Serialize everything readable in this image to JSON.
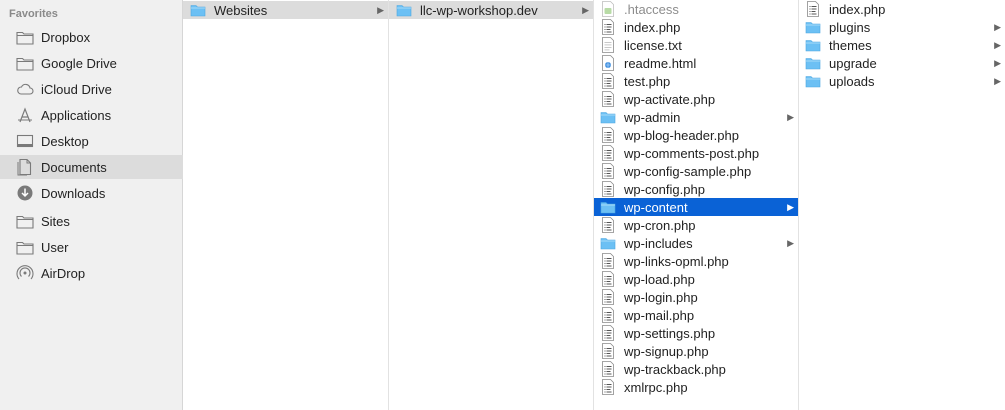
{
  "sidebar": {
    "header": "Favorites",
    "items": [
      {
        "label": "Dropbox",
        "icon": "folder-icon"
      },
      {
        "label": "Google Drive",
        "icon": "folder-icon"
      },
      {
        "label": "iCloud Drive",
        "icon": "cloud-icon"
      },
      {
        "label": "Applications",
        "icon": "applications-icon"
      },
      {
        "label": "Desktop",
        "icon": "desktop-icon"
      },
      {
        "label": "Documents",
        "icon": "documents-icon",
        "selected": true
      },
      {
        "label": "Downloads",
        "icon": "downloads-icon"
      },
      {
        "label": "Sites",
        "icon": "folder-icon"
      },
      {
        "label": "User",
        "icon": "folder-icon"
      },
      {
        "label": "AirDrop",
        "icon": "airdrop-icon"
      }
    ]
  },
  "column1": {
    "items": [
      {
        "label": "Websites",
        "icon": "folder-icon",
        "has_children": true,
        "selected": true
      }
    ]
  },
  "column2": {
    "items": [
      {
        "label": "llc-wp-workshop.dev",
        "icon": "folder-icon",
        "has_children": true,
        "selected": true
      }
    ]
  },
  "column3": {
    "items": [
      {
        "label": ".htaccess",
        "icon": "hidden-file-icon",
        "dim": true
      },
      {
        "label": "index.php",
        "icon": "php-file-icon"
      },
      {
        "label": "license.txt",
        "icon": "text-file-icon"
      },
      {
        "label": "readme.html",
        "icon": "html-file-icon"
      },
      {
        "label": "test.php",
        "icon": "php-file-icon"
      },
      {
        "label": "wp-activate.php",
        "icon": "php-file-icon"
      },
      {
        "label": "wp-admin",
        "icon": "folder-icon",
        "has_children": true
      },
      {
        "label": "wp-blog-header.php",
        "icon": "php-file-icon"
      },
      {
        "label": "wp-comments-post.php",
        "icon": "php-file-icon"
      },
      {
        "label": "wp-config-sample.php",
        "icon": "php-file-icon"
      },
      {
        "label": "wp-config.php",
        "icon": "php-file-icon"
      },
      {
        "label": "wp-content",
        "icon": "folder-icon",
        "has_children": true,
        "selected": true
      },
      {
        "label": "wp-cron.php",
        "icon": "php-file-icon"
      },
      {
        "label": "wp-includes",
        "icon": "folder-icon",
        "has_children": true
      },
      {
        "label": "wp-links-opml.php",
        "icon": "php-file-icon"
      },
      {
        "label": "wp-load.php",
        "icon": "php-file-icon"
      },
      {
        "label": "wp-login.php",
        "icon": "php-file-icon"
      },
      {
        "label": "wp-mail.php",
        "icon": "php-file-icon"
      },
      {
        "label": "wp-settings.php",
        "icon": "php-file-icon"
      },
      {
        "label": "wp-signup.php",
        "icon": "php-file-icon"
      },
      {
        "label": "wp-trackback.php",
        "icon": "php-file-icon"
      },
      {
        "label": "xmlrpc.php",
        "icon": "php-file-icon"
      }
    ]
  },
  "column4": {
    "items": [
      {
        "label": "index.php",
        "icon": "php-file-icon"
      },
      {
        "label": "plugins",
        "icon": "folder-icon",
        "has_children": true
      },
      {
        "label": "themes",
        "icon": "folder-icon",
        "has_children": true
      },
      {
        "label": "upgrade",
        "icon": "folder-icon",
        "has_children": true
      },
      {
        "label": "uploads",
        "icon": "folder-icon",
        "has_children": true
      }
    ]
  },
  "colors": {
    "selection_blue": "#0a62d6",
    "selection_gray": "#dcdcdc",
    "folder_blue": "#6cc0f4"
  }
}
